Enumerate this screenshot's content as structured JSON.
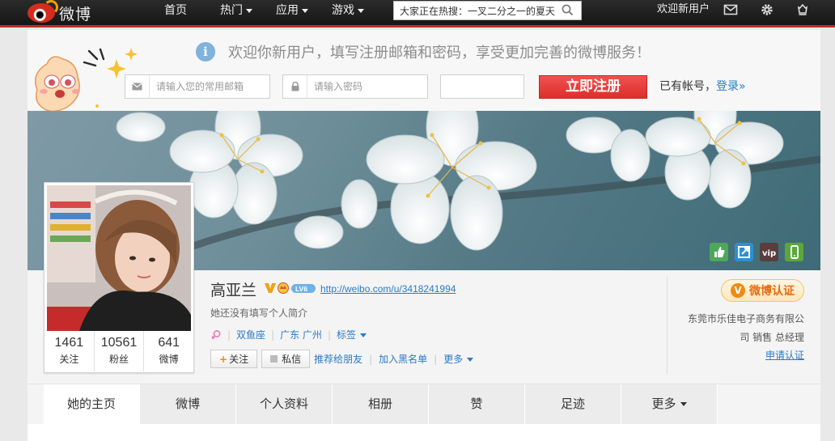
{
  "topnav": {
    "logo_text": "微博",
    "links": [
      {
        "label": "首页",
        "has_caret": false
      },
      {
        "label": "热门",
        "has_caret": true
      },
      {
        "label": "应用",
        "has_caret": true
      },
      {
        "label": "游戏",
        "has_caret": true
      }
    ],
    "search_value": "大家正在热搜：一叉二分之一的夏天",
    "welcome": "欢迎新用户",
    "icons": [
      "mail-icon",
      "gear-icon",
      "crown-icon"
    ]
  },
  "register": {
    "tip": "欢迎你新用户，填写注册邮箱和密码，享受更加完善的微博服务！",
    "email_placeholder": "请输入您的常用邮箱",
    "password_placeholder": "请输入密码",
    "captcha_value": "",
    "submit_label": "立即注册",
    "have_account": "已有帐号，",
    "login_label": "登录»"
  },
  "profile": {
    "name": "高亚兰",
    "level_badge": "LV6",
    "url": "http://weibo.com/u/3418241994",
    "bio": "她还没有填写个人简介",
    "zodiac": "双鱼座",
    "location": "广东 广州",
    "tags_label": "标签",
    "stats": [
      {
        "num": "1461",
        "label": "关注"
      },
      {
        "num": "10561",
        "label": "粉丝"
      },
      {
        "num": "641",
        "label": "微博"
      }
    ],
    "actions": {
      "follow": "关注",
      "message": "私信",
      "recommend": "推荐给朋友",
      "blacklist": "加入黑名单",
      "more": "更多"
    }
  },
  "verify": {
    "badge": "微博认证",
    "company_line1": "东莞市乐佳电子商务有限公",
    "company_line2": "司 销售 总经理",
    "apply": "申请认证"
  },
  "tabs": [
    "她的主页",
    "微博",
    "个人资料",
    "相册",
    "赞",
    "足迹",
    "更多"
  ],
  "colors": {
    "topbar": "#1e1e1e",
    "accent_red": "#e0302d",
    "link_blue": "#2a7ac8",
    "verify_orange": "#e86a0f"
  }
}
